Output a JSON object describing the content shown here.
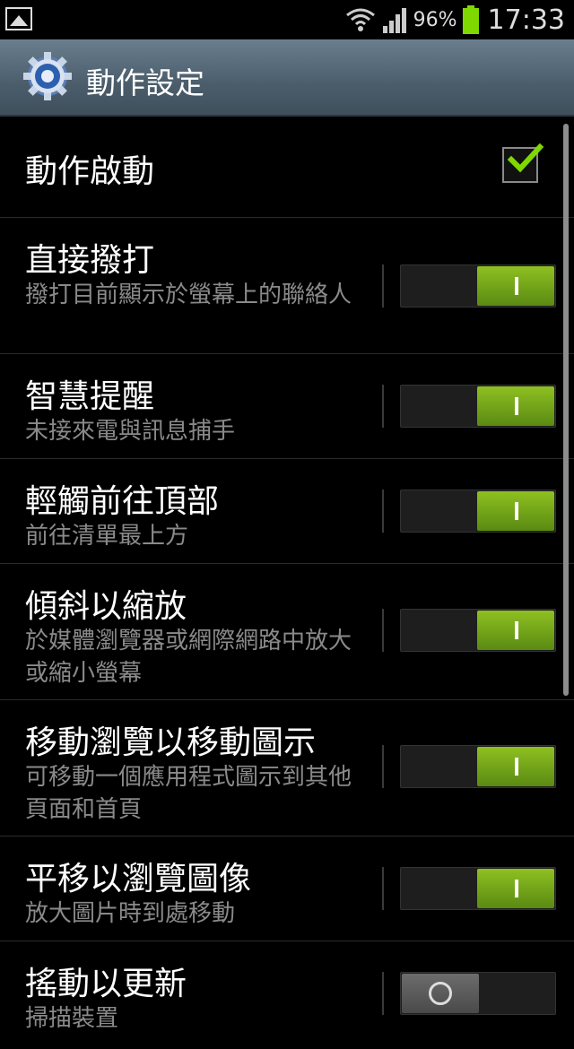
{
  "status_bar": {
    "battery_percent": "96%",
    "time": "17:33",
    "icons": [
      "image-notification-icon",
      "wifi-icon",
      "signal-icon",
      "battery-icon"
    ]
  },
  "header": {
    "title": "動作設定",
    "icon": "settings-gear-icon"
  },
  "items": [
    {
      "title": "動作啟動",
      "control": "checkbox",
      "checked": true
    },
    {
      "title": "直接撥打",
      "desc": "撥打目前顯示於螢幕上的聯絡人",
      "control": "toggle",
      "on": true
    },
    {
      "title": "智慧提醒",
      "desc": "未接來電與訊息捕手",
      "control": "toggle",
      "on": true
    },
    {
      "title": "輕觸前往頂部",
      "desc": "前往清單最上方",
      "control": "toggle",
      "on": true
    },
    {
      "title": "傾斜以縮放",
      "desc": "於媒體瀏覽器或網際網路中放大或縮小螢幕",
      "control": "toggle",
      "on": true
    },
    {
      "title": "移動瀏覽以移動圖示",
      "desc": "可移動一個應用程式圖示到其他頁面和首頁",
      "control": "toggle",
      "on": true
    },
    {
      "title": "平移以瀏覽圖像",
      "desc": "放大圖片時到處移動",
      "control": "toggle",
      "on": true
    },
    {
      "title": "搖動以更新",
      "desc": "掃描裝置",
      "control": "toggle",
      "on": false
    }
  ],
  "colors": {
    "accent_green": "#7fd800",
    "toggle_on": "#6a9a17",
    "header_bg": "#55697a"
  }
}
